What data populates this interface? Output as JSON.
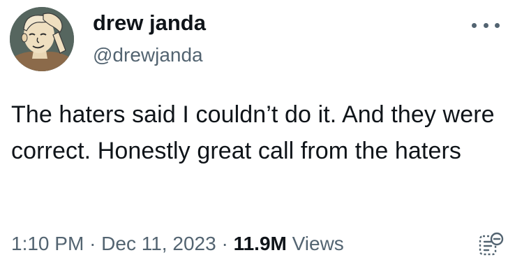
{
  "tweet": {
    "author": {
      "display_name": "drew janda",
      "handle": "@drewjanda",
      "avatar_icon": "avatar-cartoon-boy"
    },
    "more_icon": "more-horizontal-icon",
    "text": "The haters said I couldn’t do it. And they were correct. Honestly great call from the haters",
    "meta": {
      "time": "1:10 PM",
      "separator": "·",
      "date": "Dec 11, 2023",
      "views_count": "11.9M",
      "views_label": "Views"
    },
    "analytics_icon": "analytics-icon"
  },
  "colors": {
    "primary_text": "#0f1419",
    "secondary_text": "#536471",
    "background": "#ffffff"
  }
}
